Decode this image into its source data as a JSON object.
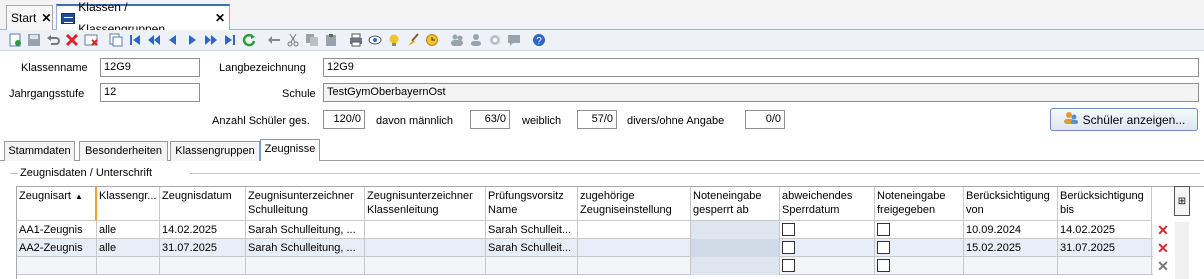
{
  "tabs": [
    {
      "label": "Start",
      "close": "✕"
    },
    {
      "label": "Klassen / Klassengruppen",
      "close": "✕"
    }
  ],
  "toolbar": {
    "icons": [
      "new-icon",
      "save-icon",
      "undo-icon",
      "delete-icon",
      "delete-form-icon",
      "copy-form-icon",
      "first-icon",
      "prev-page-icon",
      "prev-icon",
      "next-icon",
      "next-page-icon",
      "last-icon",
      "refresh-icon",
      "back-arrow-icon",
      "cut-icon",
      "copy-icon",
      "paste-icon",
      "print-icon",
      "preview-icon",
      "hint-icon",
      "broom-icon",
      "clock-icon",
      "users-icon",
      "user-icon",
      "settings-icon",
      "message-icon",
      "help-icon"
    ]
  },
  "form": {
    "klassenname_label": "Klassenname",
    "klassenname_value": "12G9",
    "langbez_label": "Langbezeichnung",
    "langbez_value": "12G9",
    "jahrgang_label": "Jahrgangsstufe",
    "jahrgang_value": "12",
    "schule_label": "Schule",
    "schule_value": "TestGymOberbayernOst",
    "anzahl_label": "Anzahl Schüler ges.",
    "anzahl_value": "120/0",
    "maennlich_label": "davon männlich",
    "maennlich_value": "63/0",
    "weiblich_label": "weiblich",
    "weiblich_value": "57/0",
    "divers_label": "divers/ohne Angabe",
    "divers_value": "0/0",
    "show_students_button": "Schüler anzeigen..."
  },
  "content_tabs": [
    "Stammdaten",
    "Besonderheiten",
    "Klassengruppen",
    "Zeugnisse"
  ],
  "group_title": "Zeugnisdaten / Unterschrift",
  "grid": {
    "headers": [
      [
        "Zeugnisart",
        ""
      ],
      [
        "Klassengr...",
        ""
      ],
      [
        "Zeugnisdatum",
        ""
      ],
      [
        "Zeugnisunterzeichner",
        "Schulleitung"
      ],
      [
        "Zeugnisunterzeichner",
        "Klassenleitung"
      ],
      [
        "Prüfungsvorsitz",
        "Name"
      ],
      [
        "zugehörige",
        "Zeugniseinstellung"
      ],
      [
        "Noteneingabe",
        "gesperrt ab"
      ],
      [
        "abweichendes",
        "Sperrdatum"
      ],
      [
        "Noteneingabe",
        "freigegeben"
      ],
      [
        "Berücksichtigung",
        "von"
      ],
      [
        "Berücksichtigung",
        "bis"
      ]
    ],
    "rows": [
      {
        "zeugnisart": "AA1-Zeugnis",
        "klassengruppe": "alle",
        "datum": "14.02.2025",
        "schulleitung": "Sarah Schulleitung, ...",
        "klassenleitung": "",
        "pruefung": "Sarah Schulleit...",
        "einstellung": "",
        "gesperrt": "",
        "von": "10.09.2024",
        "bis": "14.02.2025"
      },
      {
        "zeugnisart": "AA2-Zeugnis",
        "klassengruppe": "alle",
        "datum": "31.07.2025",
        "schulleitung": "Sarah Schulleitung, ...",
        "klassenleitung": "",
        "pruefung": "Sarah Schulleit...",
        "einstellung": "",
        "gesperrt": "",
        "von": "15.02.2025",
        "bis": "31.07.2025"
      }
    ],
    "sort_indicator": "▲",
    "delete_glyph": "✕",
    "column_chooser": "⊞"
  },
  "colors": {
    "accent": "#3b6fb6",
    "delete_red": "#d9262c",
    "selected_row": "#e8eef7"
  }
}
